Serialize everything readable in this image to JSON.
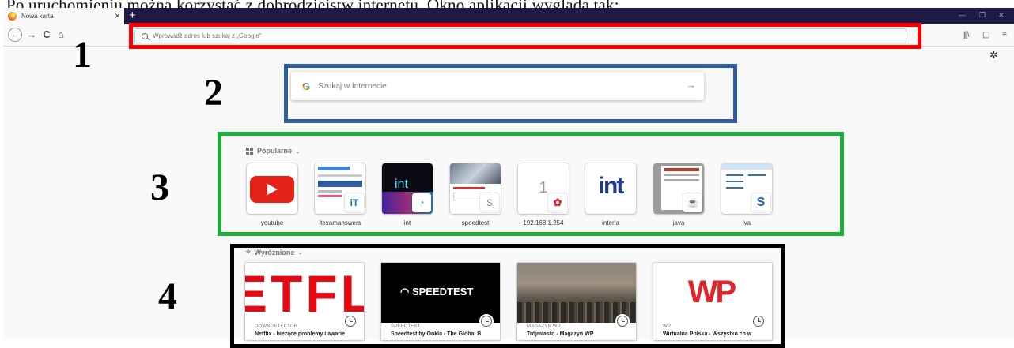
{
  "doc_heading": "Po uruchomieniu można korzystać z dobrodziejstw internetu. Okno aplikacji wygląda tak:",
  "browser": {
    "tab_title": "Nowa karta",
    "tab_close": "×",
    "new_tab": "+",
    "window_controls": [
      "—",
      "❐",
      "✕"
    ],
    "url_placeholder": "Wprowadź adres lub szukaj z „Google”",
    "nav": {
      "back": "←",
      "forward": "→",
      "reload": "C",
      "home": "⌂"
    },
    "toolbar_icons": [
      "library-icon",
      "sidebar-icon",
      "menu-icon"
    ]
  },
  "search": {
    "placeholder": "Szukaj w Internecie",
    "engine_glyph": "G",
    "arrow": "→"
  },
  "top_sites": {
    "heading": "Popularne",
    "items": [
      {
        "label": "youtube"
      },
      {
        "label": "itexamanswers"
      },
      {
        "label": "int",
        "glyph": "int"
      },
      {
        "label": "speedtest"
      },
      {
        "label": "192.168.1.254",
        "glyph": "1"
      },
      {
        "label": "interia",
        "glyph": "int"
      },
      {
        "label": "java"
      },
      {
        "label": "jva"
      }
    ]
  },
  "highlights": {
    "heading": "Wyróżnione",
    "items": [
      {
        "source": "DOWNDETECTOR",
        "title": "Netflix - bieżące problemy i awarie",
        "image_text": "ETFLI"
      },
      {
        "source": "SPEEDTEST",
        "title": "Speedtest by Ookla - The Global B",
        "image_text": "SPEEDTEST"
      },
      {
        "source": "MAGAZYN.WP",
        "title": "Trójmiasto - Magazyn WP",
        "image_text": ""
      },
      {
        "source": "WP",
        "title": "Wirtualna Polska - Wszystko co w",
        "image_text": "WP"
      }
    ]
  },
  "annotations": {
    "labels": [
      "1",
      "2",
      "3",
      "4"
    ],
    "colors": [
      "#ff0000",
      "#2f5c9b",
      "#1fad3c",
      "#000000"
    ]
  }
}
